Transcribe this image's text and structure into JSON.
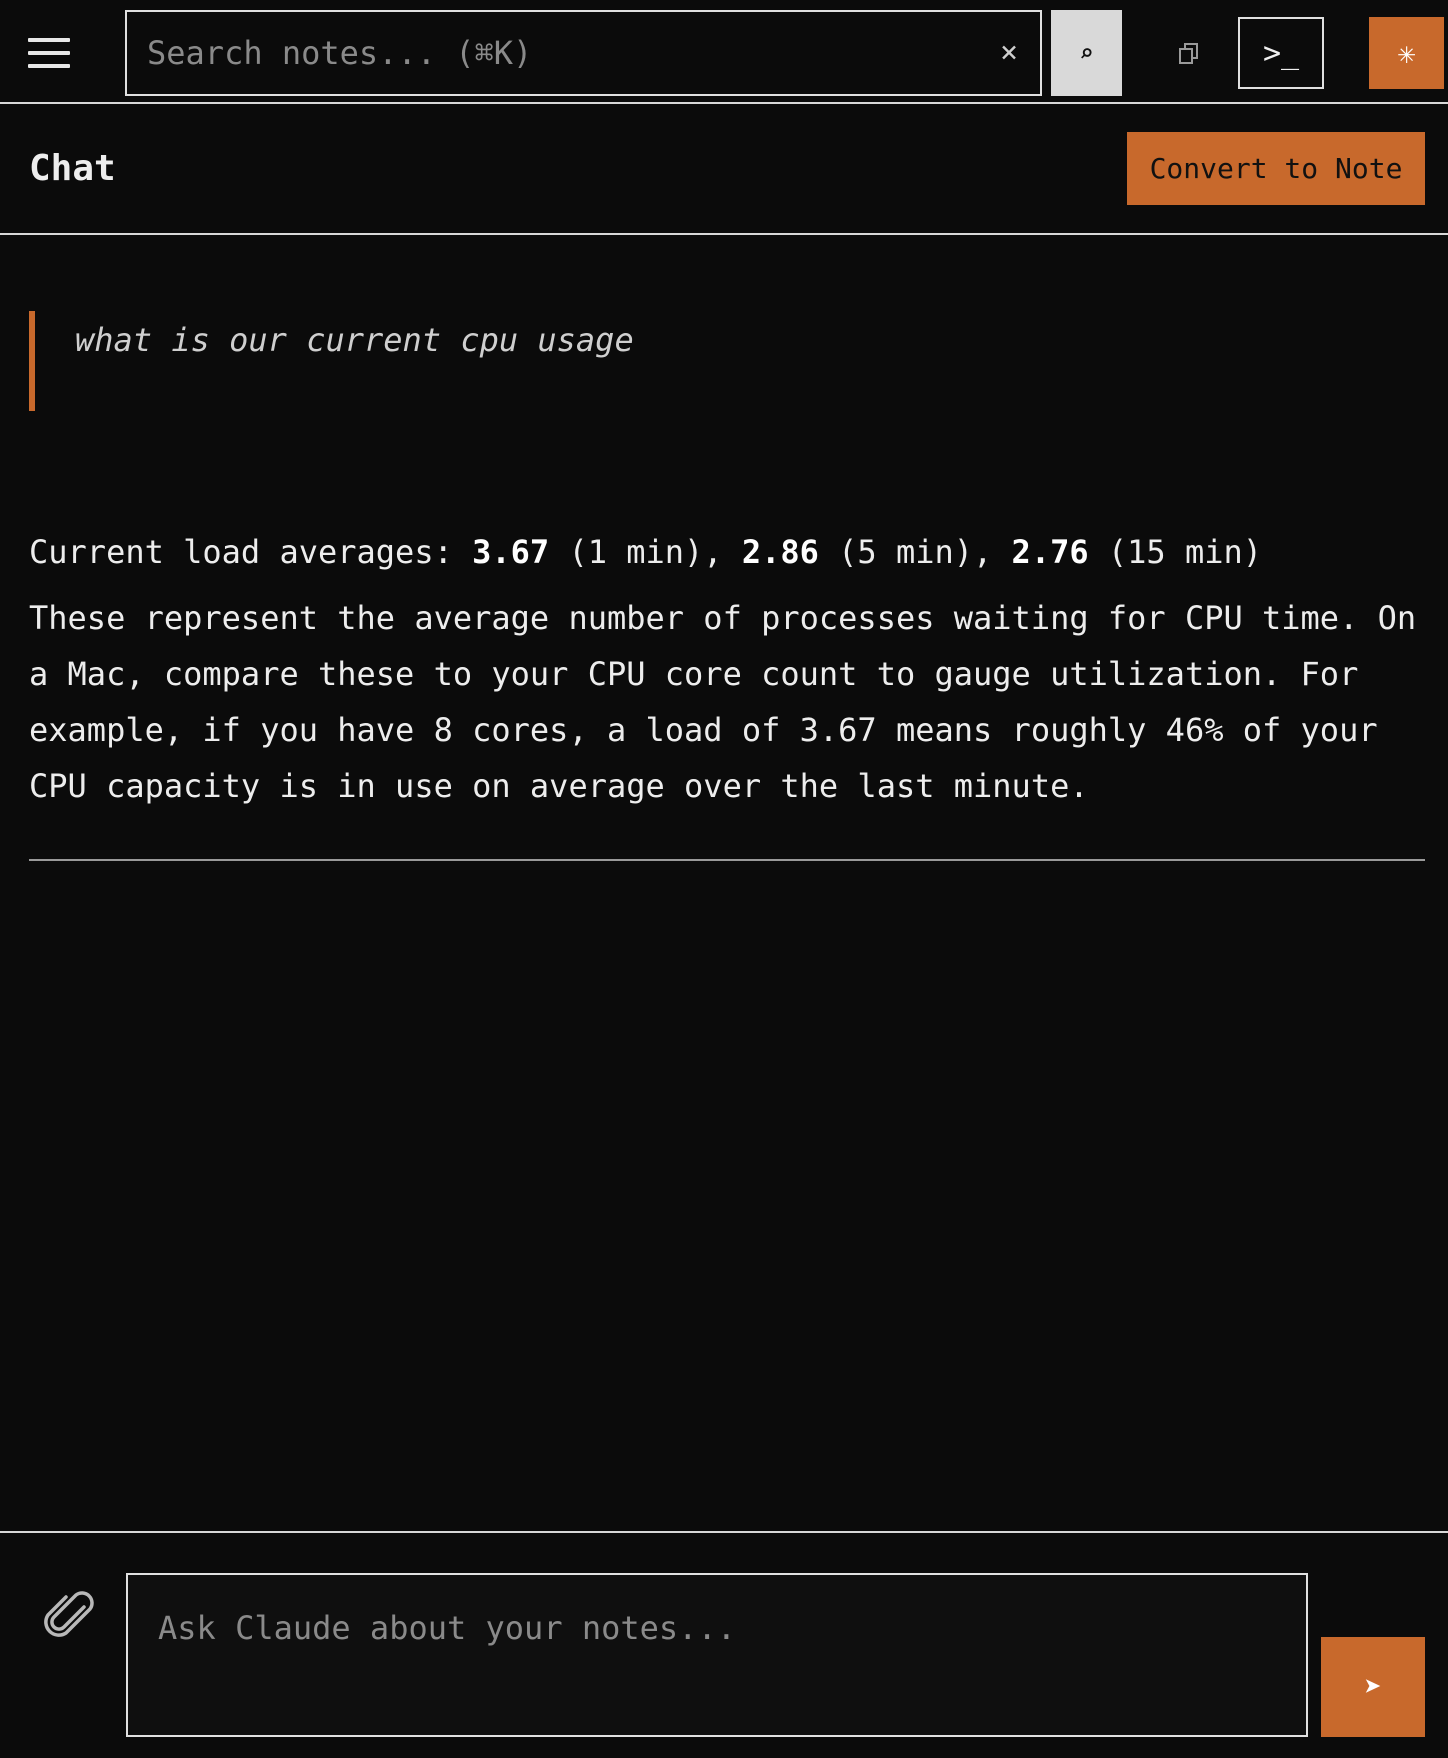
{
  "topbar": {
    "menu_icon": "hamburger-menu-icon",
    "search": {
      "placeholder": "Search notes... (⌘K)",
      "value": "",
      "clear_glyph": "×",
      "clear_icon": "close-icon"
    },
    "search_button_glyph": "⌕",
    "search_button_icon": "search-icon",
    "copy_icon": "copy-icon",
    "terminal_label": ">_",
    "terminal_icon": "terminal-icon",
    "spark_glyph": "✳",
    "spark_icon": "sparkle-icon"
  },
  "chat": {
    "title": "Chat",
    "convert_label": "Convert to Note"
  },
  "messages": {
    "user": {
      "text": "what is our current cpu usage"
    },
    "assistant": {
      "load_prefix": "Current load averages: ",
      "load_1": "3.67",
      "load_1_suffix": " (1 min), ",
      "load_5": "2.86",
      "load_5_suffix": " (5 min), ",
      "load_15": "2.76",
      "load_15_suffix": " (15 min)",
      "explanation": "These represent the average number of processes waiting for CPU time. On a Mac, compare these to your CPU core count to gauge utilization. For example, if you have 8 cores, a load of 3.67 means roughly 46% of your CPU capacity is in use on average over the last minute."
    }
  },
  "composer": {
    "attach_icon": "paperclip-icon",
    "placeholder": "Ask Claude about your notes...",
    "value": "",
    "send_glyph": "➤",
    "send_icon": "send-icon"
  },
  "colors": {
    "background": "#0b0b0b",
    "accent": "#c8692c",
    "text": "#ededed",
    "muted": "#8a8a8a"
  }
}
